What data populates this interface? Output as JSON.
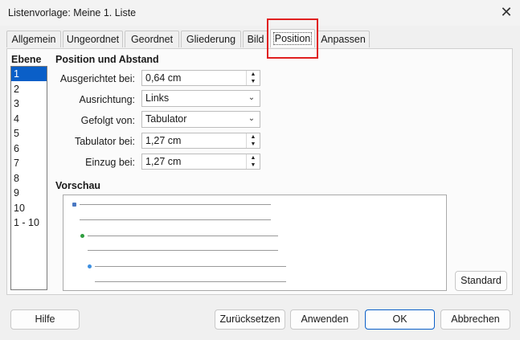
{
  "window": {
    "title": "Listenvorlage: Meine 1. Liste",
    "close_glyph": "✕"
  },
  "tabs": [
    {
      "label": "Allgemein"
    },
    {
      "label": "Ungeordnet"
    },
    {
      "label": "Geordnet"
    },
    {
      "label": "Gliederung"
    },
    {
      "label": "Bild"
    },
    {
      "label": "Position",
      "active": true
    },
    {
      "label": "Anpassen"
    }
  ],
  "levels": {
    "header": "Ebene",
    "items": [
      "1",
      "2",
      "3",
      "4",
      "5",
      "6",
      "7",
      "8",
      "9",
      "10",
      "1 - 10"
    ],
    "selected": "1"
  },
  "position": {
    "title": "Position und Abstand",
    "aligned_at": {
      "label": "Ausgerichtet bei:",
      "value": "0,64 cm"
    },
    "alignment": {
      "label": "Ausrichtung:",
      "value": "Links"
    },
    "followed_by": {
      "label": "Gefolgt von:",
      "value": "Tabulator"
    },
    "tab_at": {
      "label": "Tabulator bei:",
      "value": "1,27 cm"
    },
    "indent_at": {
      "label": "Einzug bei:",
      "value": "1,27 cm"
    }
  },
  "preview": {
    "title": "Vorschau",
    "bullet_colors": [
      "#4a78c2",
      "#2f9e3f",
      "#3d8fe0"
    ]
  },
  "buttons": {
    "standard": "Standard",
    "help": "Hilfe",
    "reset": "Zurücksetzen",
    "apply": "Anwenden",
    "ok": "OK",
    "cancel": "Abbrechen"
  },
  "colors": {
    "selection": "#0a5fc8",
    "highlight_box": "#e02020"
  }
}
